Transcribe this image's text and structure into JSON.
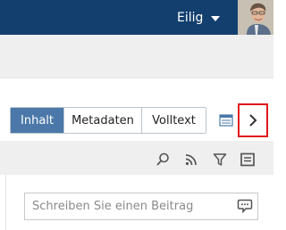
{
  "header": {
    "user_label": "Eilig",
    "icons": {
      "caret": "caret-down-icon",
      "avatar": "user-avatar"
    }
  },
  "view_tabs": [
    {
      "label": "Inhalt",
      "active": true
    },
    {
      "label": "Metadaten",
      "active": false
    },
    {
      "label": "Volltext",
      "active": false
    }
  ],
  "view_icons": {
    "document": "document-view-icon",
    "next": "chevron-right-icon"
  },
  "toolbar": {
    "icons": [
      "search-icon",
      "rss-icon",
      "filter-icon",
      "comment-list-icon"
    ]
  },
  "post": {
    "placeholder": "Schreiben Sie einen Beitrag",
    "value": "",
    "icon": "speech-bubble-icon"
  },
  "colors": {
    "header_bg": "#133f6e",
    "active_tab": "#4b78a9",
    "highlight": "#e0181b"
  }
}
